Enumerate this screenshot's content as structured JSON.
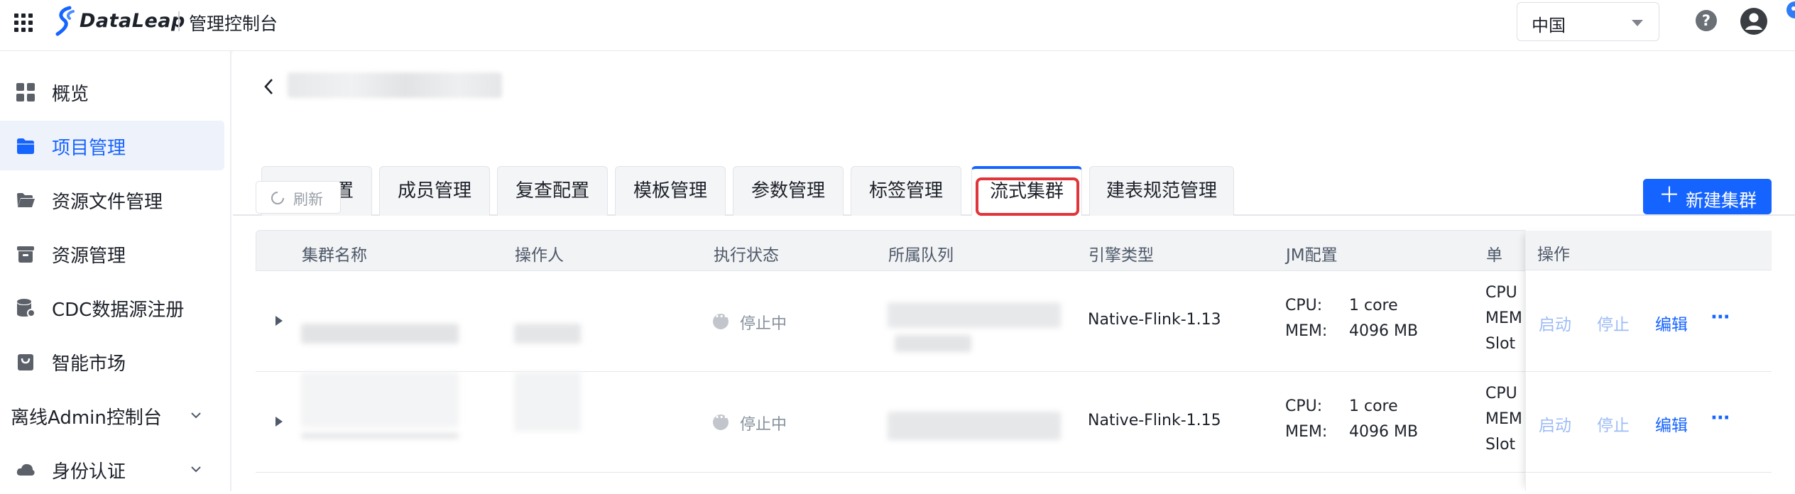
{
  "header": {
    "brand": "DataLeap",
    "console_title": "管理控制台",
    "region_value": "中国",
    "help_symbol": "?"
  },
  "sidebar": {
    "items": [
      {
        "label": "概览",
        "icon": "dashboard-icon"
      },
      {
        "label": "项目管理",
        "icon": "folder-icon",
        "active": true
      },
      {
        "label": "资源文件管理",
        "icon": "folder-open-icon"
      },
      {
        "label": "资源管理",
        "icon": "box-icon"
      },
      {
        "label": "CDC数据源注册",
        "icon": "database-icon"
      },
      {
        "label": "智能市场",
        "icon": "shopping-bag-icon"
      },
      {
        "label": "离线Admin控制台",
        "icon": "",
        "expandable": true
      },
      {
        "label": "身份认证",
        "icon": "cloud-icon",
        "expandable": true
      }
    ]
  },
  "tabs": [
    {
      "label": "项目配置"
    },
    {
      "label": "成员管理"
    },
    {
      "label": "复查配置"
    },
    {
      "label": "模板管理"
    },
    {
      "label": "参数管理"
    },
    {
      "label": "标签管理"
    },
    {
      "label": "流式集群",
      "active": true
    },
    {
      "label": "建表规范管理"
    }
  ],
  "toolbar": {
    "refresh_label": "刷新",
    "new_cluster_label": "新建集群",
    "plus": "＋"
  },
  "table": {
    "columns": [
      "集群名称",
      "操作人",
      "执行状态",
      "所属队列",
      "引擎类型",
      "JM配置",
      "单",
      "操作"
    ],
    "rows": [
      {
        "status": "停止中",
        "engine": "Native-Flink-1.13",
        "jm_cpu_key": "CPU:",
        "jm_cpu_val": "1 core",
        "jm_mem_key": "MEM:",
        "jm_mem_val": "4096 MB",
        "tm_lines": [
          "CPU",
          "MEM",
          "Slot"
        ],
        "actions": {
          "start": "启动",
          "stop": "停止",
          "edit": "编辑",
          "more": "···"
        }
      },
      {
        "status": "停止中",
        "engine": "Native-Flink-1.15",
        "jm_cpu_key": "CPU:",
        "jm_cpu_val": "1 core",
        "jm_mem_key": "MEM:",
        "jm_mem_val": "4096 MB",
        "tm_lines": [
          "CPU",
          "MEM",
          "Slot"
        ],
        "actions": {
          "start": "启动",
          "stop": "停止",
          "edit": "编辑",
          "more": "···"
        }
      }
    ]
  },
  "colors": {
    "primary": "#1664ff",
    "highlight_box": "#e0353b",
    "active_nav_bg": "#eef2fb"
  }
}
